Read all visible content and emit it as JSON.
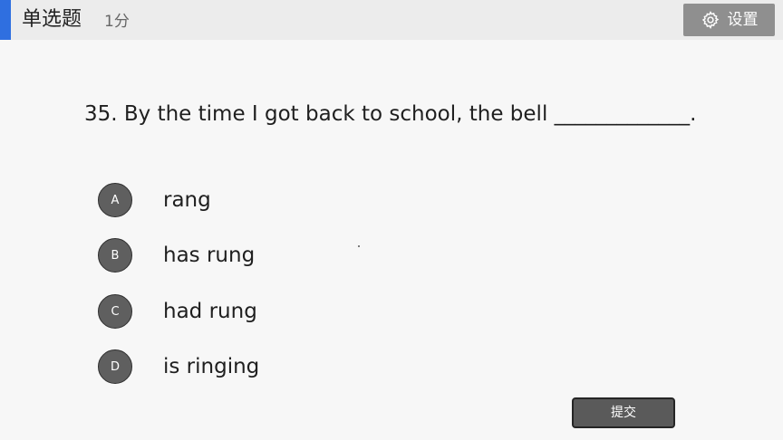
{
  "header": {
    "question_type": "单选题",
    "score": "1分",
    "settings_label": "设置",
    "settings_icon": "gear-icon",
    "accent_color": "#2f6fe0"
  },
  "question": {
    "text": "35. By the time I got back to school, the bell _____________."
  },
  "options": [
    {
      "letter": "A",
      "text": "rang"
    },
    {
      "letter": "B",
      "text": "has rung"
    },
    {
      "letter": "C",
      "text": "had rung"
    },
    {
      "letter": "D",
      "text": "is ringing"
    }
  ],
  "submit": {
    "label": "提交"
  }
}
